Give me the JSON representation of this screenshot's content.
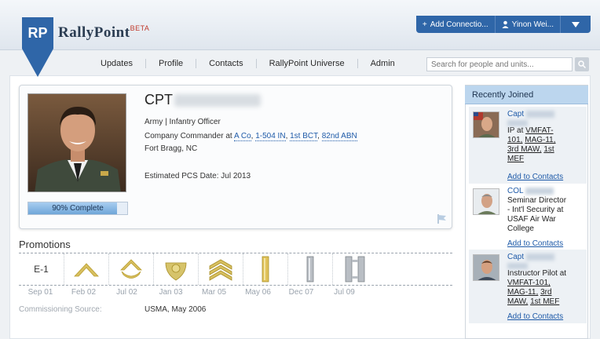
{
  "brand": {
    "badge": "RP",
    "name": "RallyPoint",
    "beta": "BETA"
  },
  "userbar": {
    "add_connection": "Add Connectio...",
    "user_name": "Yinon Wei..."
  },
  "nav": {
    "items": [
      "Updates",
      "Profile",
      "Contacts",
      "RallyPoint Universe",
      "Admin"
    ]
  },
  "search": {
    "placeholder": "Search for people and units..."
  },
  "profile": {
    "rank": "CPT",
    "line1": "Army | Infantry Officer",
    "role_prefix": "Company Commander at",
    "units": [
      "A Co",
      "1-504 IN",
      "1st BCT",
      "82nd ABN"
    ],
    "location": "Fort Bragg, NC",
    "pcs": "Estimated PCS Date: Jul 2013",
    "progress_label": "90% Complete",
    "progress_pct": 90
  },
  "promotions": {
    "title": "Promotions",
    "first_label": "E-1",
    "dates": [
      "Sep 01",
      "Feb 02",
      "Jul 02",
      "Jan 03",
      "Mar 05",
      "May 06",
      "Dec 07",
      "Jul 09"
    ],
    "commissioning_label": "Commissioning Source:",
    "commissioning_value": "USMA, May 2006"
  },
  "sidebar": {
    "title": "Recently Joined",
    "members": [
      {
        "rank": "Capt",
        "lines": [
          "IP at",
          "VMFAT-",
          "101,",
          "MAG-11,",
          "3rd MAW,",
          "1st",
          "MEF"
        ],
        "add": "Add to Contacts"
      },
      {
        "rank": "COL",
        "lines": [
          "Seminar Director",
          "- Int'l Security at",
          "USAF Air War",
          "College"
        ],
        "add": "Add to Contacts"
      },
      {
        "rank": "Capt",
        "lines": [
          "Instructor Pilot at",
          "VMFAT-101,",
          "MAG-11,",
          "3rd",
          "MAW,",
          "1st MEF"
        ],
        "add": "Add to Contacts"
      }
    ]
  },
  "colors": {
    "brand_blue": "#2f66a8",
    "link": "#1e5aa8",
    "sidebar_header": "#bcd6ee"
  }
}
